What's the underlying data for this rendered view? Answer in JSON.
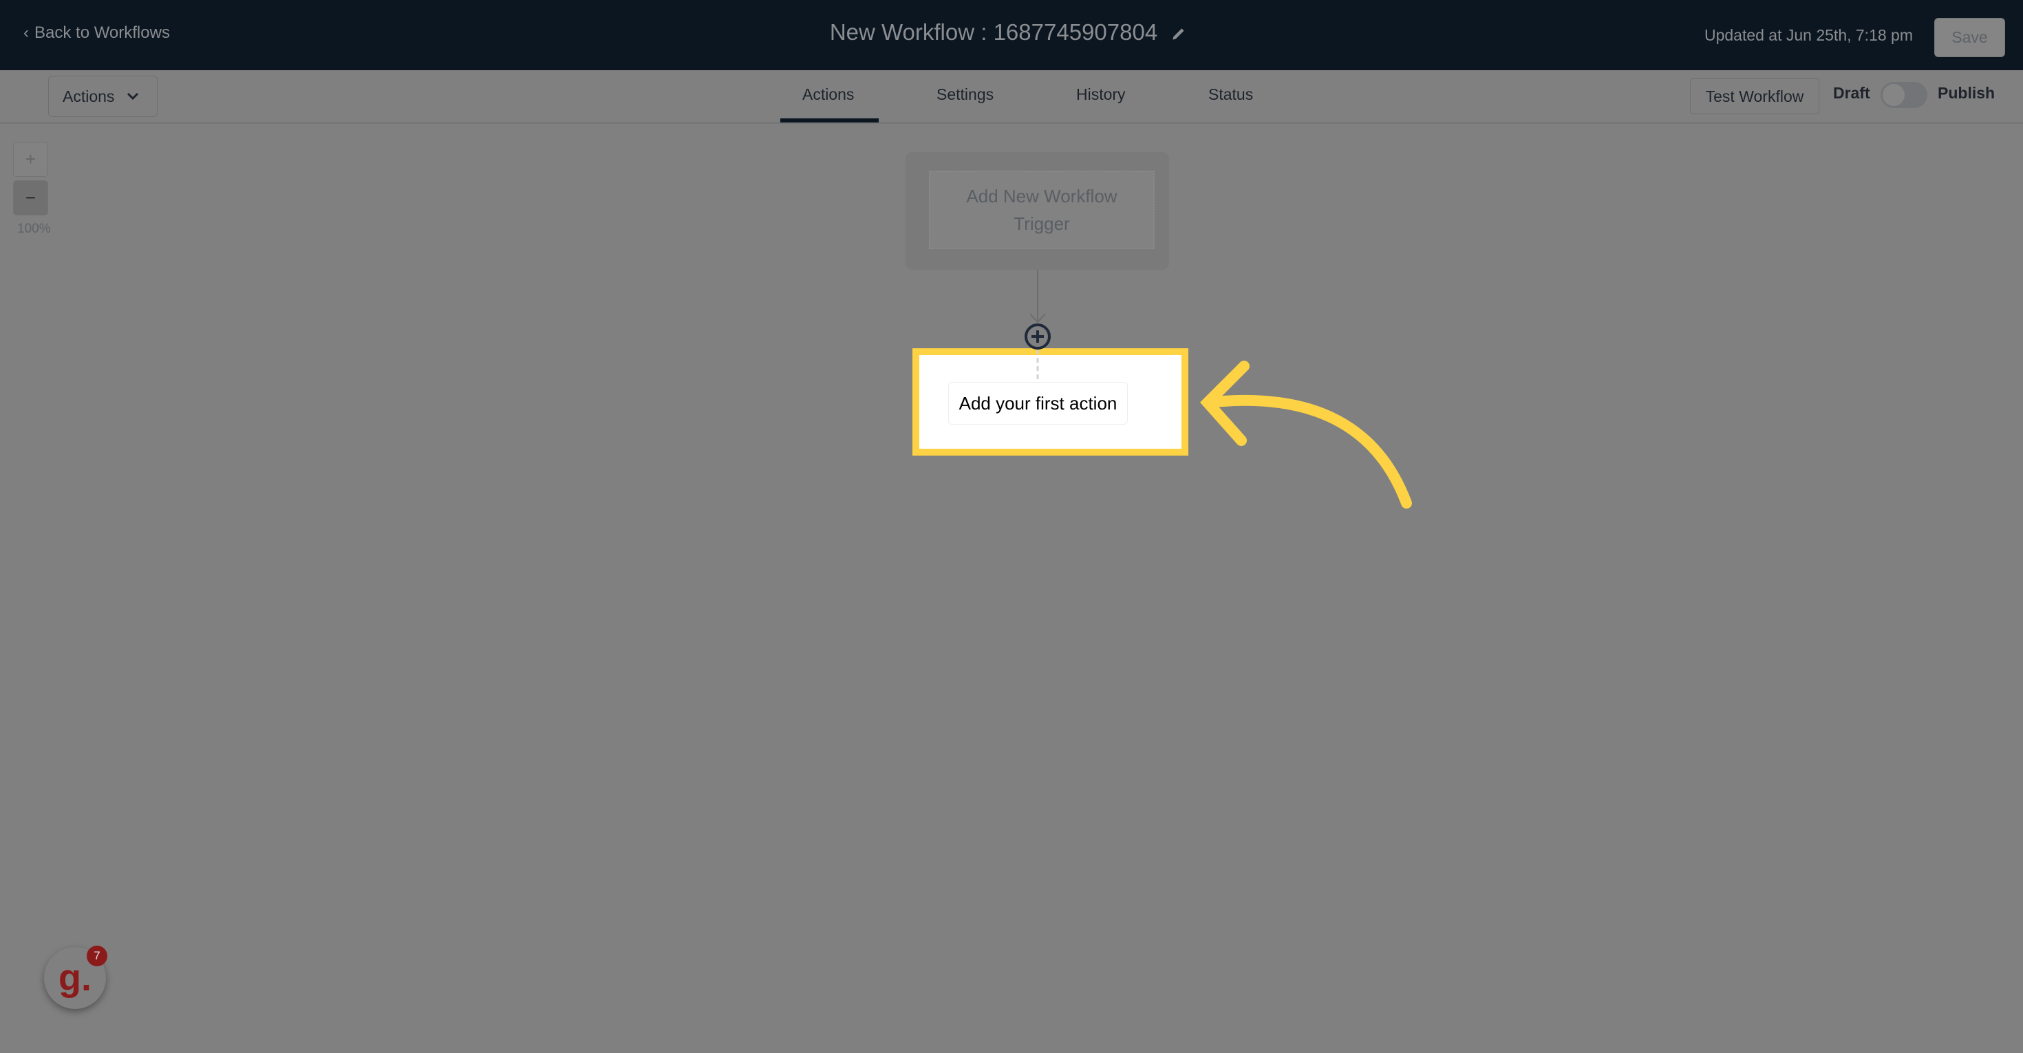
{
  "header": {
    "back_label": "Back to Workflows",
    "title": "New Workflow : 1687745907804",
    "updated": "Updated at Jun 25th, 7:18 pm",
    "save_label": "Save"
  },
  "toolbar": {
    "actions_dropdown": "Actions",
    "tabs": [
      {
        "label": "Actions",
        "active": true
      },
      {
        "label": "Settings"
      },
      {
        "label": "History"
      },
      {
        "label": "Status"
      }
    ],
    "test_label": "Test Workflow",
    "draft_label": "Draft",
    "publish_label": "Publish",
    "published": false
  },
  "zoom": {
    "in": "+",
    "out": "−",
    "level": "100%"
  },
  "canvas": {
    "trigger_label": "Add New Workflow Trigger",
    "action_label": "Add your first action"
  },
  "chat": {
    "logo": "g.",
    "badge": "7"
  },
  "colors": {
    "header": "#0c1620",
    "highlight": "#fdd244",
    "badge": "#8b1a1a"
  },
  "icons": {
    "back": "chevron-left-icon",
    "edit": "pencil-icon",
    "dropdown": "chevron-down-icon",
    "add": "plus-circle-icon",
    "annotation": "curved-arrow-icon"
  }
}
